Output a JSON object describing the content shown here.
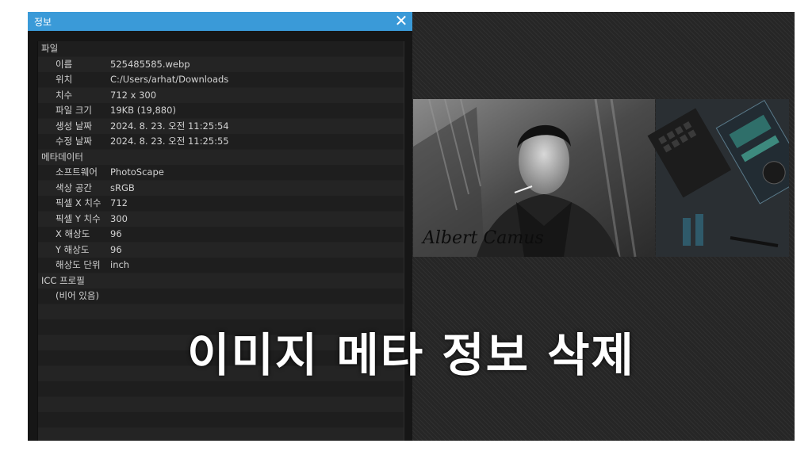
{
  "window": {
    "title": "정보"
  },
  "info": {
    "sections": [
      {
        "label": "파일",
        "items": [
          {
            "key": "이름",
            "value": "525485585.webp"
          },
          {
            "key": "위치",
            "value": "C:/Users/arhat/Downloads"
          },
          {
            "key": "치수",
            "value": "712 x 300"
          },
          {
            "key": "파일 크기",
            "value": "19KB (19,880)"
          },
          {
            "key": "생성 날짜",
            "value": "2024. 8. 23. 오전 11:25:54"
          },
          {
            "key": "수정 날짜",
            "value": "2024. 8. 23. 오전 11:25:55"
          }
        ]
      },
      {
        "label": "메타데이터",
        "items": [
          {
            "key": "소프트웨어",
            "value": "PhotoScape"
          },
          {
            "key": "색상 공간",
            "value": "sRGB"
          },
          {
            "key": "픽셀 X 치수",
            "value": "712"
          },
          {
            "key": "픽셀 Y 치수",
            "value": "300"
          },
          {
            "key": "X 해상도",
            "value": "96"
          },
          {
            "key": "Y 해상도",
            "value": "96"
          },
          {
            "key": "해상도 단위",
            "value": "inch"
          }
        ]
      },
      {
        "label": "ICC 프로필",
        "items": [
          {
            "key": "(비어 있음)",
            "value": ""
          }
        ]
      }
    ]
  },
  "preview": {
    "signature_text": "Albert Camus"
  },
  "caption": {
    "text": "이미지 메타 정보 삭제"
  },
  "colors": {
    "titlebar": "#3a9ad8",
    "panel": "#161616",
    "text": "#d2d2d2"
  }
}
